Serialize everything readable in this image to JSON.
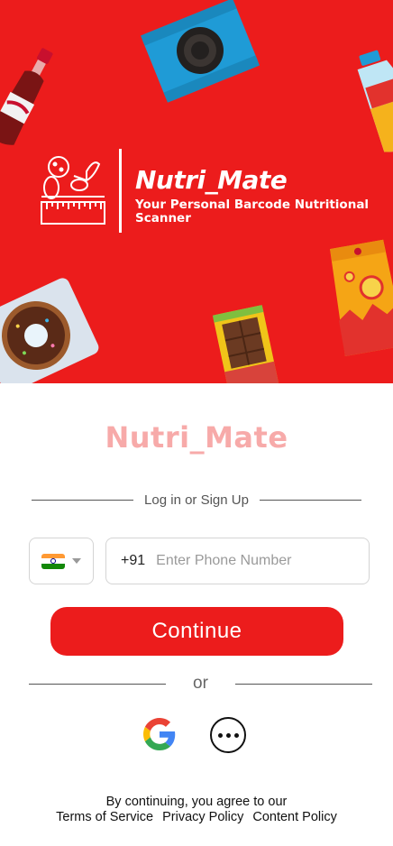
{
  "hero": {
    "title": "Nutri_Mate",
    "subtitle": "Your Personal Barcode Nutritional Scanner"
  },
  "brand": {
    "name": "Nutri_Mate"
  },
  "auth": {
    "divider_label": "Log in or Sign Up",
    "country_flag": "india-flag-icon",
    "dial_code": "+91",
    "phone_placeholder": "Enter Phone Number",
    "phone_value": "",
    "continue_label": "Continue",
    "or_label": "or"
  },
  "social": {
    "google_icon": "google-icon",
    "more_icon": "more-options-icon"
  },
  "legal": {
    "line1": "By continuing, you agree to our",
    "terms": "Terms of Service",
    "privacy": "Privacy Policy",
    "content": "Content Policy"
  },
  "colors": {
    "accent": "#ec1c1c",
    "brand_text": "#f7aaa9"
  }
}
